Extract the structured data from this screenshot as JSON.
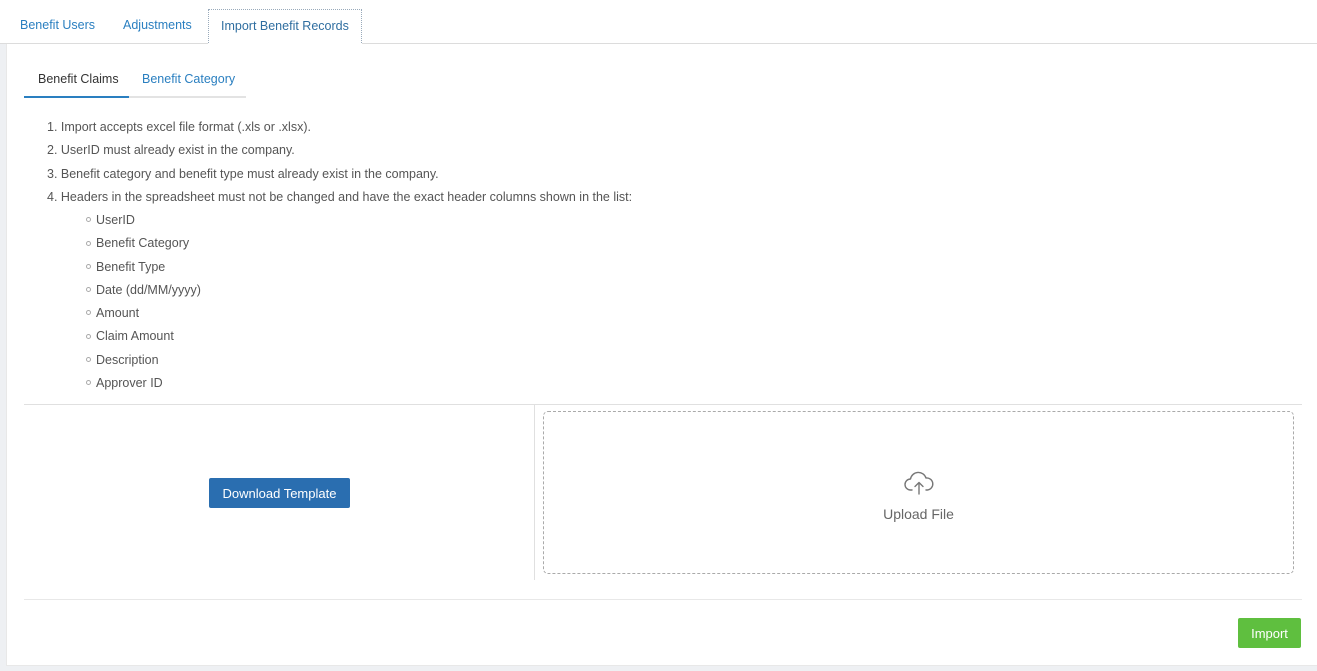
{
  "top_tabs": [
    {
      "label": "Benefit Users"
    },
    {
      "label": "Adjustments"
    },
    {
      "label": "Import Benefit Records"
    }
  ],
  "sub_tabs": [
    {
      "label": "Benefit Claims"
    },
    {
      "label": "Benefit Category"
    }
  ],
  "instructions": [
    "1. Import accepts excel file format (.xls or .xlsx).",
    "2. UserID must already exist in the company.",
    "3. Benefit category and benefit type must already exist in the company.",
    "4. Headers in the spreadsheet must not be changed and have the exact header columns shown in the list:"
  ],
  "headers": [
    "UserID",
    "Benefit Category",
    "Benefit Type",
    "Date (dd/MM/yyyy)",
    "Amount",
    "Claim Amount",
    "Description",
    "Approver ID"
  ],
  "download_label": "Download Template",
  "upload_label": "Upload File",
  "upload_icon": "cloud-upload-icon",
  "import_label": "Import",
  "colors": {
    "link": "#2a7fc0",
    "primary_button": "#2a6eb0",
    "success_button": "#5fbf3f"
  }
}
